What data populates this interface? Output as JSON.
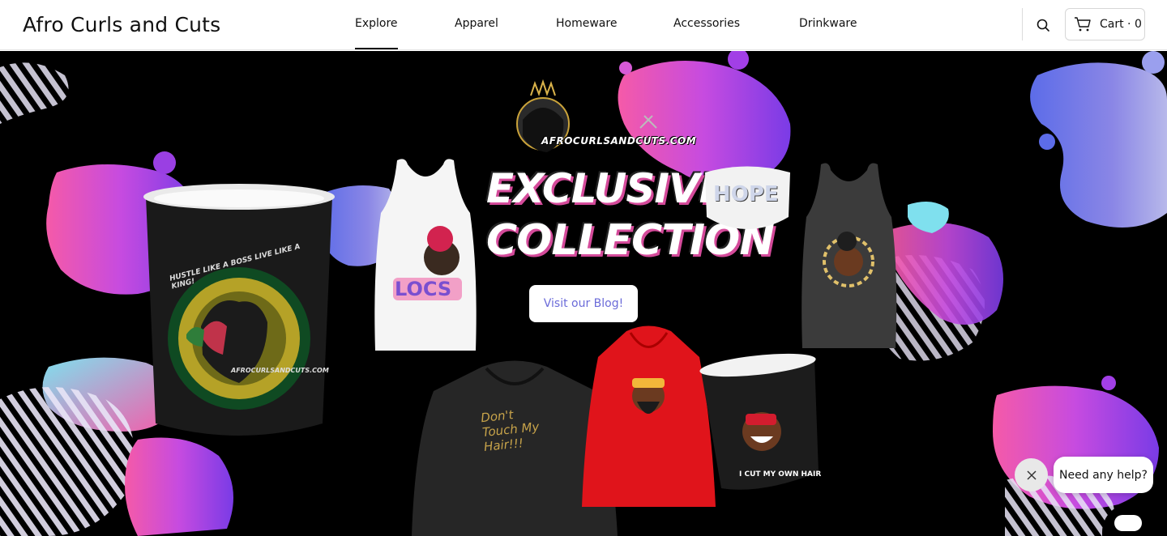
{
  "header": {
    "brand": "Afro Curls and Cuts",
    "nav": [
      {
        "label": "Explore",
        "active": true
      },
      {
        "label": "Apparel",
        "active": false
      },
      {
        "label": "Homeware",
        "active": false
      },
      {
        "label": "Accessories",
        "active": false
      },
      {
        "label": "Drinkware",
        "active": false
      }
    ],
    "search_icon": "search-icon",
    "cart_label": "Cart · 0",
    "cart_icon": "cart-icon"
  },
  "hero": {
    "logo_text": "AFROCURLSANDCUTS.COM",
    "headline_line1": "EXCLUSIVE",
    "headline_line2": "COLLECTION",
    "cta_label": "Visit our Blog!",
    "products": {
      "mug_text": "HUSTLE LIKE A BOSS LIVE LIKE A KING!",
      "mug_brand": "AFROCURLSANDCUTS.COM",
      "white_tank_text": "LOCS",
      "mask_text": "HOPE",
      "hoodie_black_text": "Don't Touch My Hair!!!",
      "small_mug_text": "I CUT MY OWN HAIR"
    },
    "colors": {
      "pink": "#f0509f",
      "purple": "#8b3be0",
      "blue": "#6a7be8",
      "cyan": "#6fd6e8"
    }
  },
  "chat": {
    "help_label": "Need any help?",
    "close_icon": "close-icon"
  }
}
